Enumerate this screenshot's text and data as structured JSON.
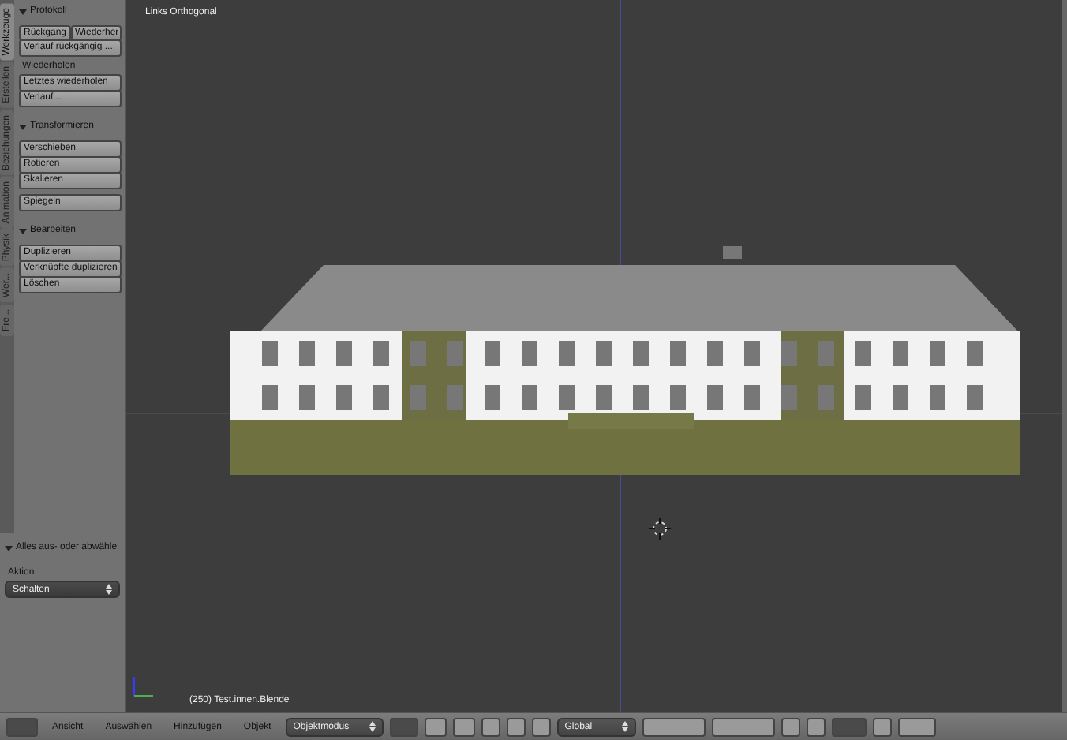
{
  "tabs": [
    {
      "label": "Werkzeuge",
      "selected": true
    },
    {
      "label": "Erstellen",
      "selected": false
    },
    {
      "label": "Beziehungen",
      "selected": false
    },
    {
      "label": "Animation",
      "selected": false
    },
    {
      "label": "Physik",
      "selected": false
    },
    {
      "label": "Wer...",
      "selected": false
    },
    {
      "label": "Fre...",
      "selected": false
    }
  ],
  "panels": [
    {
      "title": "Protokoll",
      "expanded": true,
      "items": [
        {
          "kind": "row",
          "buttons": [
            "Rückgang",
            "Wiederher"
          ]
        },
        {
          "kind": "button",
          "label": "Verlauf rückgängig ..."
        },
        {
          "kind": "label",
          "text": "Wiederholen"
        },
        {
          "kind": "button",
          "label": "Letztes wiederholen"
        },
        {
          "kind": "button",
          "label": "Verlauf..."
        }
      ]
    },
    {
      "title": "Transformieren",
      "expanded": true,
      "items": [
        {
          "kind": "button",
          "label": "Verschieben"
        },
        {
          "kind": "button",
          "label": "Rotieren"
        },
        {
          "kind": "button",
          "label": "Skalieren"
        },
        {
          "kind": "spacer"
        },
        {
          "kind": "button",
          "label": "Spiegeln"
        }
      ]
    },
    {
      "title": "Bearbeiten",
      "expanded": true,
      "items": [
        {
          "kind": "button",
          "label": "Duplizieren"
        },
        {
          "kind": "button",
          "label": "Verknüpfte duplizieren"
        },
        {
          "kind": "button",
          "label": "Löschen"
        }
      ]
    }
  ],
  "operator": {
    "title": "Alles aus- oder abwähle",
    "expanded": true,
    "field_label": "Aktion",
    "value": "Schalten"
  },
  "viewport": {
    "view_name": "Links Orthogonal",
    "object_info": "(250) Test.innen.Blende"
  },
  "header": {
    "menus": [
      "Ansicht",
      "Auswählen",
      "Hinzufügen",
      "Objekt"
    ],
    "mode": "Objektmodus",
    "orientation": "Global"
  }
}
